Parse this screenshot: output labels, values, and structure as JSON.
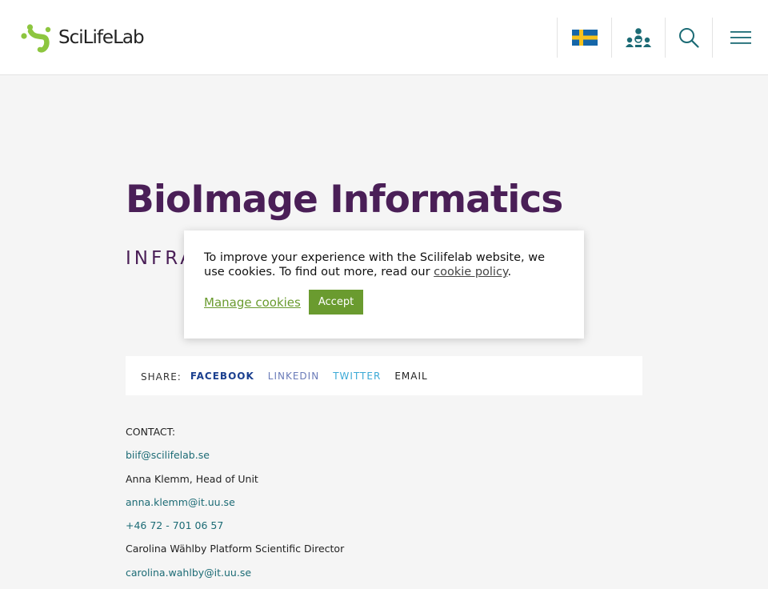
{
  "header": {
    "logo_text": "SciLifeLab",
    "language_icon": "swedish-flag-icon",
    "people_icon": "people-network-icon",
    "search_icon": "search-icon",
    "menu_icon": "hamburger-menu-icon"
  },
  "colors": {
    "brand_purple": "#4a1f57",
    "brand_green": "#6a9b2f",
    "link_teal": "#1c6b75"
  },
  "page": {
    "title": "BioImage Informatics",
    "subtitle": "INFRA"
  },
  "share": {
    "label": "SHARE:",
    "facebook": "FACEBOOK",
    "linkedin": "LINKEDIN",
    "twitter": "TWITTER",
    "email": "EMAIL"
  },
  "contact": {
    "heading": "CONTACT:",
    "lines": [
      {
        "text": "biif@scilifelab.se",
        "link": true
      },
      {
        "text": "Anna Klemm, Head of Unit",
        "link": false
      },
      {
        "text": "anna.klemm@it.uu.se",
        "link": true
      },
      {
        "text": "+46 72 - 701 06 57",
        "link": true
      },
      {
        "text": "Carolina Wählby Platform Scientific Director",
        "link": false
      },
      {
        "text": "carolina.wahlby@it.uu.se",
        "link": true
      }
    ]
  },
  "cookie": {
    "text_before": "To improve your experience with the Scilifelab website, we use cookies. To find out more, read our ",
    "policy_link": "cookie policy",
    "text_after": ".",
    "manage_label": "Manage cookies",
    "accept_label": "Accept"
  }
}
